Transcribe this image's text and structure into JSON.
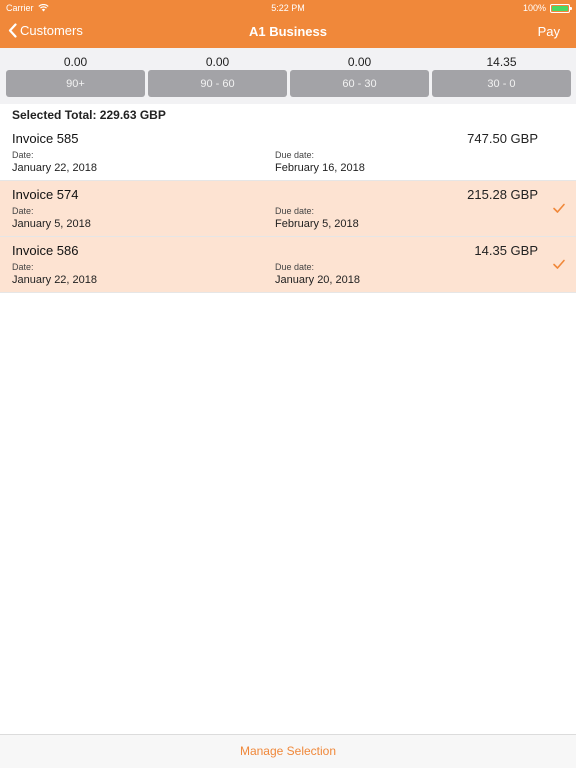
{
  "status_bar": {
    "carrier": "Carrier",
    "time": "5:22 PM",
    "battery": "100%",
    "battery_level": 1.0
  },
  "nav": {
    "back_label": "Customers",
    "title": "A1 Business",
    "action_label": "Pay"
  },
  "aging": [
    {
      "amount": "0.00",
      "bucket": "90+"
    },
    {
      "amount": "0.00",
      "bucket": "90 - 60"
    },
    {
      "amount": "0.00",
      "bucket": "60 - 30"
    },
    {
      "amount": "14.35",
      "bucket": "30 - 0"
    }
  ],
  "selected_total": "Selected Total: 229.63 GBP",
  "invoices": [
    {
      "title": "Invoice 585",
      "amount": "747.50 GBP",
      "date_label": "Date:",
      "date": "January 22, 2018",
      "due_label": "Due date:",
      "due_date": "February 16, 2018",
      "selected": false
    },
    {
      "title": "Invoice 574",
      "amount": "215.28 GBP",
      "date_label": "Date:",
      "date": "January 5, 2018",
      "due_label": "Due date:",
      "due_date": "February 5, 2018",
      "selected": true
    },
    {
      "title": "Invoice 586",
      "amount": "14.35 GBP",
      "date_label": "Date:",
      "date": "January 22, 2018",
      "due_label": "Due date:",
      "due_date": "January 20, 2018",
      "selected": true
    }
  ],
  "footer": {
    "manage_label": "Manage Selection"
  },
  "colors": {
    "accent": "#f0883a",
    "selected_row": "#fde3d2",
    "bucket_button": "#a3a3a7"
  },
  "icons": {
    "wifi": "wifi-icon",
    "back": "chevron-left-icon",
    "check": "checkmark-icon",
    "battery": "battery-icon"
  }
}
